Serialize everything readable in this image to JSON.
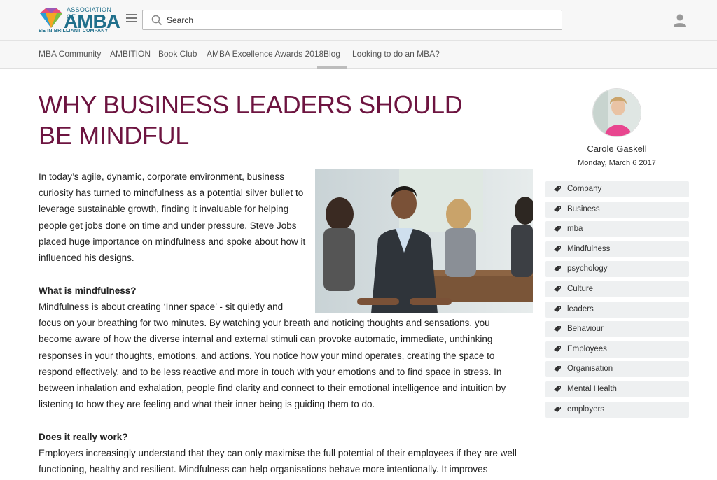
{
  "header": {
    "logo": {
      "association": "ASSOCIATION OF",
      "brand": "AMBA",
      "tagline": "BE IN BRILLIANT COMPANY"
    },
    "search_placeholder": "Search",
    "menu_icon": "hamburger-icon",
    "user_icon": "user-icon"
  },
  "nav": {
    "items": [
      {
        "label": "MBA Community"
      },
      {
        "label": "AMBITION"
      },
      {
        "label": "Book Club"
      },
      {
        "label": "AMBA Excellence Awards 2018"
      },
      {
        "label": "Blog"
      },
      {
        "label": "Looking to do an MBA?"
      }
    ],
    "active": "Blog"
  },
  "article": {
    "title": "WHY BUSINESS LEADERS SHOULD BE MINDFUL",
    "intro_lines": [
      "In today’s agile, dynamic, corporate environment, business",
      "curiosity has turned to mindfulness as a potential silver bullet to",
      "leverage sustainable growth, finding it invaluable for helping",
      "people get jobs done on time and under pressure. Steve Jobs",
      "placed huge importance on mindfulness and spoke about how it",
      "influenced his designs."
    ],
    "heading1": "What is mindfulness?",
    "body1_lines": [
      "Mindfulness is about creating ‘Inner space’ - sit quietly and",
      "focus on your breathing for two minutes. By watching your breath and noticing thoughts and sensations, you",
      "become aware of how the diverse internal and external stimuli can provoke automatic, immediate, unthinking",
      "responses in your thoughts, emotions, and actions. You notice how your mind operates, creating the space to",
      "respond effectively, and to be less reactive and more in touch with your emotions and to find space in stress. In",
      "between inhalation and exhalation, people find clarity and connect to their emotional intelligence and intuition by",
      "listening to how they are feeling and what their inner being is guiding them to do."
    ],
    "heading2": "Does it really work?",
    "body2_lines": [
      "Employers increasingly understand that they can only maximise the full potential of their employees if they are well",
      "functioning, healthy and resilient. Mindfulness can help organisations behave more intentionally. It improves"
    ]
  },
  "sidebar": {
    "author": "Carole Gaskell",
    "date": "Monday, March 6 2017",
    "tag_icon": "tag-icon",
    "tags": [
      "Company",
      "Business",
      "mba",
      "Mindfulness",
      "psychology",
      "Culture",
      "leaders",
      "Behaviour",
      "Employees",
      "Organisation",
      "Mental Health",
      "employers"
    ]
  },
  "colors": {
    "title": "#6d1440",
    "brand": "#1f6f8b",
    "tag_bg": "#eef0f1"
  }
}
